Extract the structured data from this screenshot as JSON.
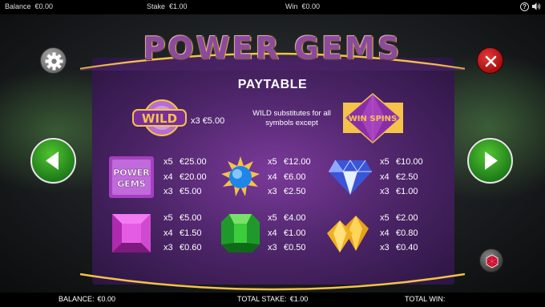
{
  "topbar": {
    "balance_label": "Balance",
    "balance_value": "€0.00",
    "stake_label": "Stake",
    "stake_value": "€1.00",
    "win_label": "Win",
    "win_value": "€0.00",
    "help_glyph": "?"
  },
  "game": {
    "logo_text": "POWER GEMS",
    "paytable_title": "PAYTABLE",
    "wild_badge": "WILD",
    "win_spins_badge": "WIN SPINS",
    "power_gems_badge_line1": "POWER",
    "power_gems_badge_line2": "GEMS",
    "wild_note": "WILD substitutes for all symbols except"
  },
  "paytable": {
    "wild": {
      "mult": "x3",
      "value": "€5.00"
    },
    "power_gems": [
      {
        "mult": "x5",
        "value": "€25.00"
      },
      {
        "mult": "x4",
        "value": "€20.00"
      },
      {
        "mult": "x3",
        "value": "€5.00"
      }
    ],
    "blue_gem": [
      {
        "mult": "x5",
        "value": "€12.00"
      },
      {
        "mult": "x4",
        "value": "€6.00"
      },
      {
        "mult": "x3",
        "value": "€2.50"
      }
    ],
    "diamond": [
      {
        "mult": "x5",
        "value": "€10.00"
      },
      {
        "mult": "x4",
        "value": "€2.50"
      },
      {
        "mult": "x3",
        "value": "€1.00"
      }
    ],
    "pink_gem": [
      {
        "mult": "x5",
        "value": "€5.00"
      },
      {
        "mult": "x4",
        "value": "€1.50"
      },
      {
        "mult": "x3",
        "value": "€0.60"
      }
    ],
    "green_gem": [
      {
        "mult": "x5",
        "value": "€4.00"
      },
      {
        "mult": "x4",
        "value": "€1.00"
      },
      {
        "mult": "x3",
        "value": "€0.50"
      }
    ],
    "yellow_gems": [
      {
        "mult": "x5",
        "value": "€2.00"
      },
      {
        "mult": "x4",
        "value": "€0.80"
      },
      {
        "mult": "x3",
        "value": "€0.40"
      }
    ]
  },
  "bottombar": {
    "balance_label": "BALANCE:",
    "balance_value": "€0.00",
    "total_stake_label": "TOTAL STAKE:",
    "total_stake_value": "€1.00",
    "total_win_label": "TOTAL WIN:",
    "total_win_value": ""
  },
  "colors": {
    "panel_purple": "#4d2569",
    "accent_gold": "#f5c24a",
    "nav_green": "#1f7d1b",
    "close_red": "#a80f0f"
  }
}
